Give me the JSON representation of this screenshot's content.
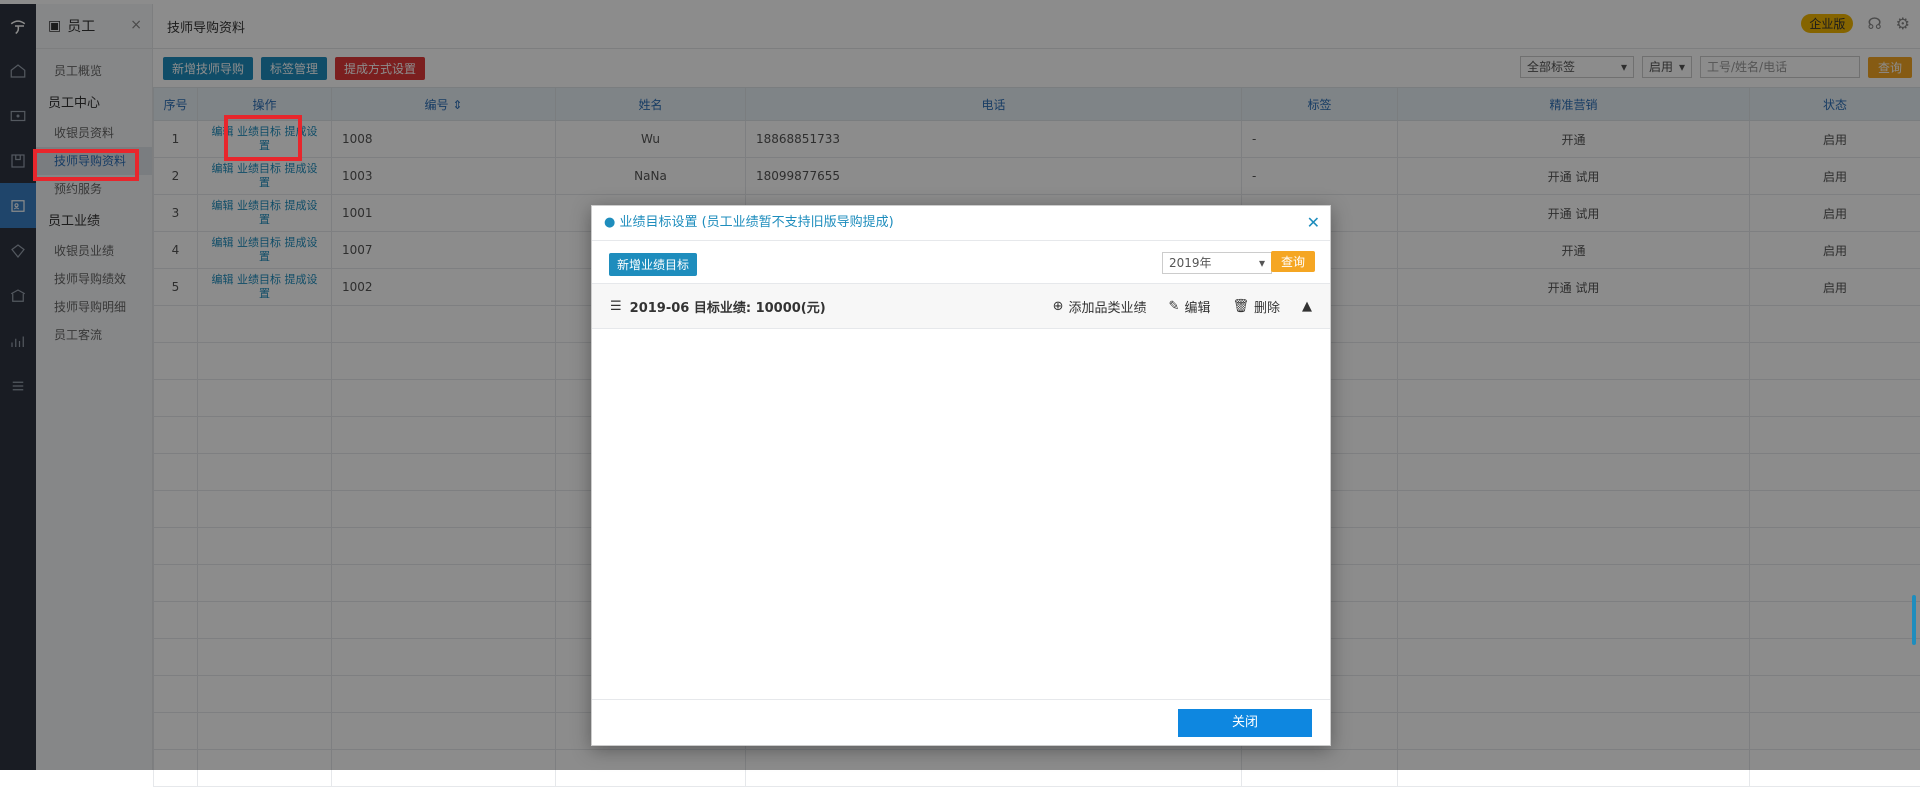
{
  "submenu": {
    "module_title": "员工",
    "items_top": [
      "员工概览"
    ],
    "group1": "员工中心",
    "group1_items": [
      "收银员资料",
      "技师导购资料",
      "预约服务"
    ],
    "group2": "员工业绩",
    "group2_items": [
      "收银员业绩",
      "技师导购绩效",
      "技师导购明细",
      "员工客流"
    ]
  },
  "header": {
    "title": "技师导购资料",
    "edition_badge": "企业版"
  },
  "toolbar": {
    "add_label": "新增技师导购",
    "tag_label": "标签管理",
    "commission_label": "提成方式设置",
    "tag_filter": "全部标签",
    "status_filter": "启用",
    "search_placeholder": "工号/姓名/电话",
    "query_label": "查询"
  },
  "table": {
    "headers": [
      "序号",
      "操作",
      "编号",
      "姓名",
      "电话",
      "标签",
      "精准营销",
      "状态"
    ],
    "op_edit": "编辑",
    "op_target": "业绩目标",
    "op_commission_a": "提成设",
    "op_commission_b": "置",
    "rows": [
      {
        "no": "1",
        "code": "1008",
        "name": "Wu",
        "phone": "18868851733",
        "tag": "-",
        "marketing": "开通",
        "status": "启用"
      },
      {
        "no": "2",
        "code": "1003",
        "name": "NaNa",
        "phone": "18099877655",
        "tag": "-",
        "marketing": "开通 试用",
        "status": "启用"
      },
      {
        "no": "3",
        "code": "1001",
        "name": "",
        "phone": "",
        "tag": "",
        "marketing": "开通 试用",
        "status": "启用"
      },
      {
        "no": "4",
        "code": "1007",
        "name": "",
        "phone": "",
        "tag": "",
        "marketing": "开通",
        "status": "启用"
      },
      {
        "no": "5",
        "code": "1002",
        "name": "",
        "phone": "",
        "tag": "",
        "marketing": "开通 试用",
        "status": "启用"
      }
    ]
  },
  "modal": {
    "title": "● 业绩目标设置 (员工业绩暂不支持旧版导购提成)",
    "add_target_label": "新增业绩目标",
    "year_value": "2019年",
    "query_label": "查询",
    "row_title": "2019-06 目标业绩: 10000(元)",
    "add_category_label": "添加品类业绩",
    "edit_label": "编辑",
    "delete_label": "删除",
    "close_label": "关闭"
  }
}
